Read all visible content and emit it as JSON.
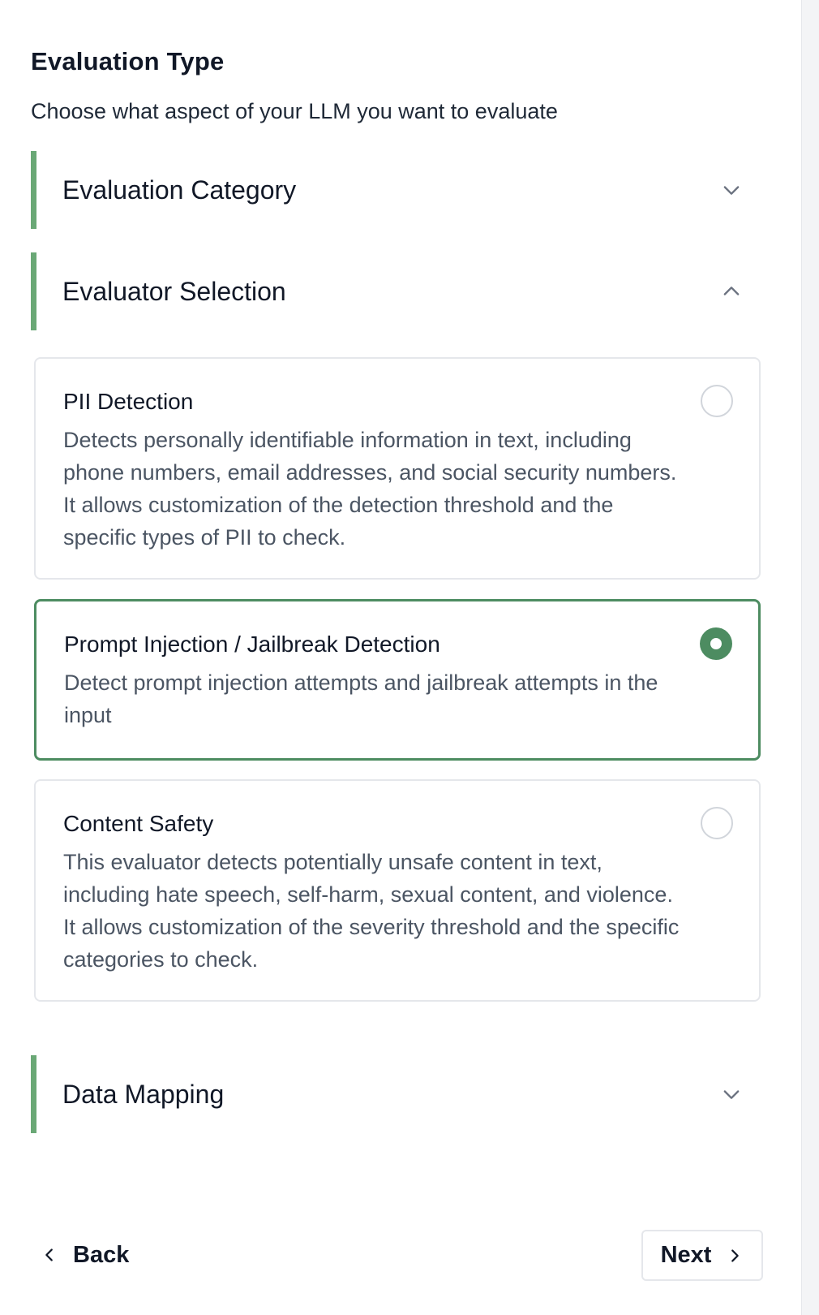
{
  "header": {
    "title": "Evaluation Type",
    "subtitle": "Choose what aspect of your LLM you want to evaluate"
  },
  "sections": {
    "category": {
      "title": "Evaluation Category",
      "expanded": false
    },
    "evaluator": {
      "title": "Evaluator Selection",
      "expanded": true
    },
    "mapping": {
      "title": "Data Mapping",
      "expanded": false
    }
  },
  "evaluators": [
    {
      "title": "PII Detection",
      "description": "Detects personally identifiable information in text, including phone numbers, email addresses, and social security numbers. It allows customization of the detection threshold and the specific types of PII to check.",
      "selected": false
    },
    {
      "title": "Prompt Injection / Jailbreak Detection",
      "description": "Detect prompt injection attempts and jailbreak attempts in the input",
      "selected": true
    },
    {
      "title": "Content Safety",
      "description": "This evaluator detects potentially unsafe content in text, including hate speech, self-harm, sexual content, and violence. It allows customization of the severity threshold and the specific categories to check.",
      "selected": false
    }
  ],
  "footer": {
    "back_label": "Back",
    "next_label": "Next"
  },
  "colors": {
    "accent": "#4d8c61",
    "section_bar": "#6aa876",
    "border": "#e5e7eb"
  },
  "icons": {
    "collapsed": "chevron-down-icon",
    "expanded": "chevron-up-icon",
    "back": "chevron-left-icon",
    "next": "chevron-right-icon"
  }
}
